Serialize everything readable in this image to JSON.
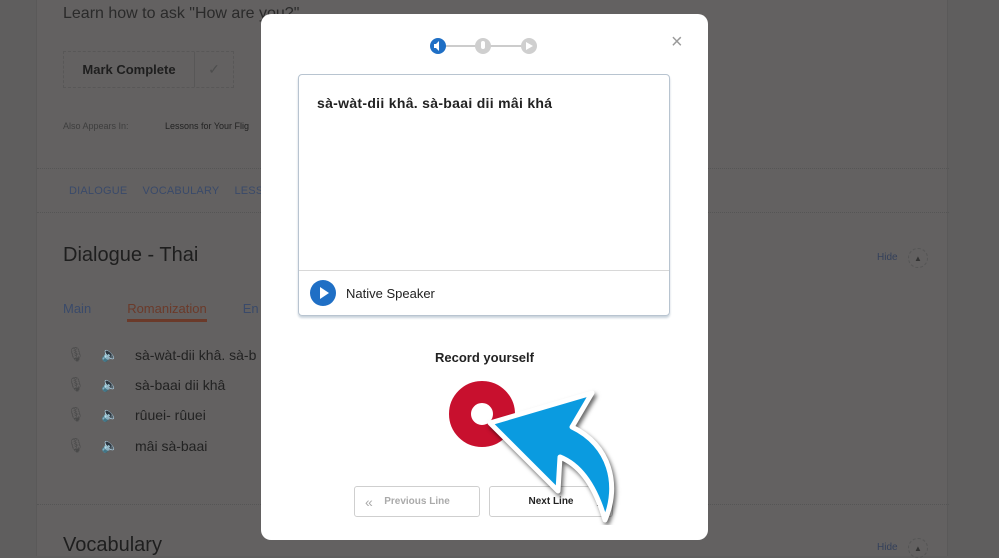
{
  "background": {
    "intro": "Learn how to ask \"How are you?\"",
    "mark_complete": "Mark Complete",
    "check_icon": "✓",
    "also_appears_label": "Also Appears In:",
    "also_appears_link": "Lessons for Your Flig",
    "tabs": [
      "DIALOGUE",
      "VOCABULARY",
      "LESSO"
    ],
    "dialogue_title": "Dialogue - Thai",
    "subtabs": [
      "Main",
      "Romanization",
      "En"
    ],
    "lines": [
      "sà-wàt-dii khâ. sà-b",
      "sà-baai dii khâ",
      "rûuei- rûuei",
      "mâi sà-baai"
    ],
    "hide": "Hide",
    "vocab_title": "Vocabulary"
  },
  "modal": {
    "close_icon": "×",
    "steps": [
      "listen",
      "record",
      "play"
    ],
    "phrase": "sà-wàt-dii khâ. sà-baai dii mâi khá",
    "native_speaker": "Native Speaker",
    "record_title": "Record yourself",
    "prev": "Previous Line",
    "prev_icon": "«",
    "next": "Next Line",
    "next_icon": "»"
  },
  "colors": {
    "accent": "#1f6fc5",
    "record": "#c8102e",
    "arrow": "#0a9be0"
  }
}
